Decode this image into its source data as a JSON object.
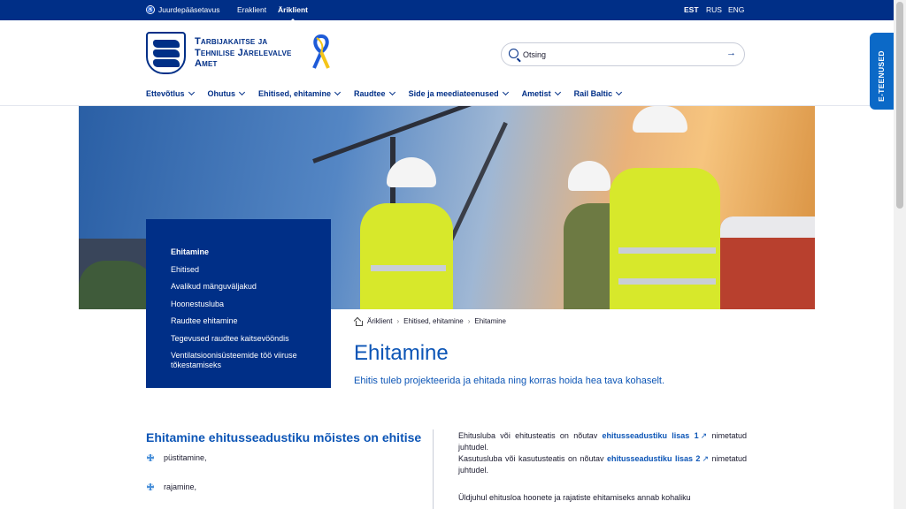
{
  "topbar": {
    "accessibility_label": "Juurdepääsetavus",
    "audiences": [
      {
        "label": "Eraklient",
        "active": false
      },
      {
        "label": "Äriklient",
        "active": true
      }
    ],
    "languages": [
      {
        "label": "EST",
        "active": true
      },
      {
        "label": "RUS",
        "active": false
      },
      {
        "label": "ENG",
        "active": false
      }
    ]
  },
  "header": {
    "org_name_line1": "Tarbijakaitse ja",
    "org_name_line2": "Tehnilise Järelevalve",
    "org_name_line3": "Amet",
    "search_placeholder": "Otsing",
    "nav": [
      "Ettevõtlus",
      "Ohutus",
      "Ehitised, ehitamine",
      "Raudtee",
      "Side ja meediateenused",
      "Ametist",
      "Rail Baltic"
    ],
    "e_services_label": "E-TEENUSED"
  },
  "sidenav": {
    "items": [
      {
        "label": "Ehitamine",
        "active": true
      },
      {
        "label": "Ehitised",
        "active": false
      },
      {
        "label": "Avalikud mänguväljakud",
        "active": false
      },
      {
        "label": "Hoonestusluba",
        "active": false
      },
      {
        "label": "Raudtee ehitamine",
        "active": false
      },
      {
        "label": "Tegevused raudtee kaitsevööndis",
        "active": false
      },
      {
        "label": "Ventilatsioonisüsteemide töö viiruse tõkestamiseks",
        "active": false
      }
    ]
  },
  "breadcrumb": [
    "Äriklient",
    "Ehitised, ehitamine",
    "Ehitamine"
  ],
  "page": {
    "title": "Ehitamine",
    "lead": "Ehitis tuleb projekteerida ja ehitada ning korras hoida hea tava kohaselt.",
    "section_title": "Ehitamine ehitusseadustiku mõistes on ehitise",
    "list": [
      "püstitamine,",
      "rajamine,"
    ],
    "para1_text": "Ehitusluba või ehitusteatis on nõutav",
    "para1_link": "ehitusseadustiku lisas 1",
    "para1_tail": "nimetatud juhtudel.",
    "para2_text": "Kasutusluba või kasutusteatis on nõutav",
    "para2_link": "ehitusseadustiku lisas 2",
    "para2_tail": "nimetatud juhtudel.",
    "para3_text": "Üldjuhul ehitusloa hoonete ja rajatiste ehitamiseks annab kohaliku"
  },
  "colors": {
    "brand_dark": "#002f87",
    "accent_blue": "#0c55b6",
    "e_services": "#0b69c7"
  }
}
